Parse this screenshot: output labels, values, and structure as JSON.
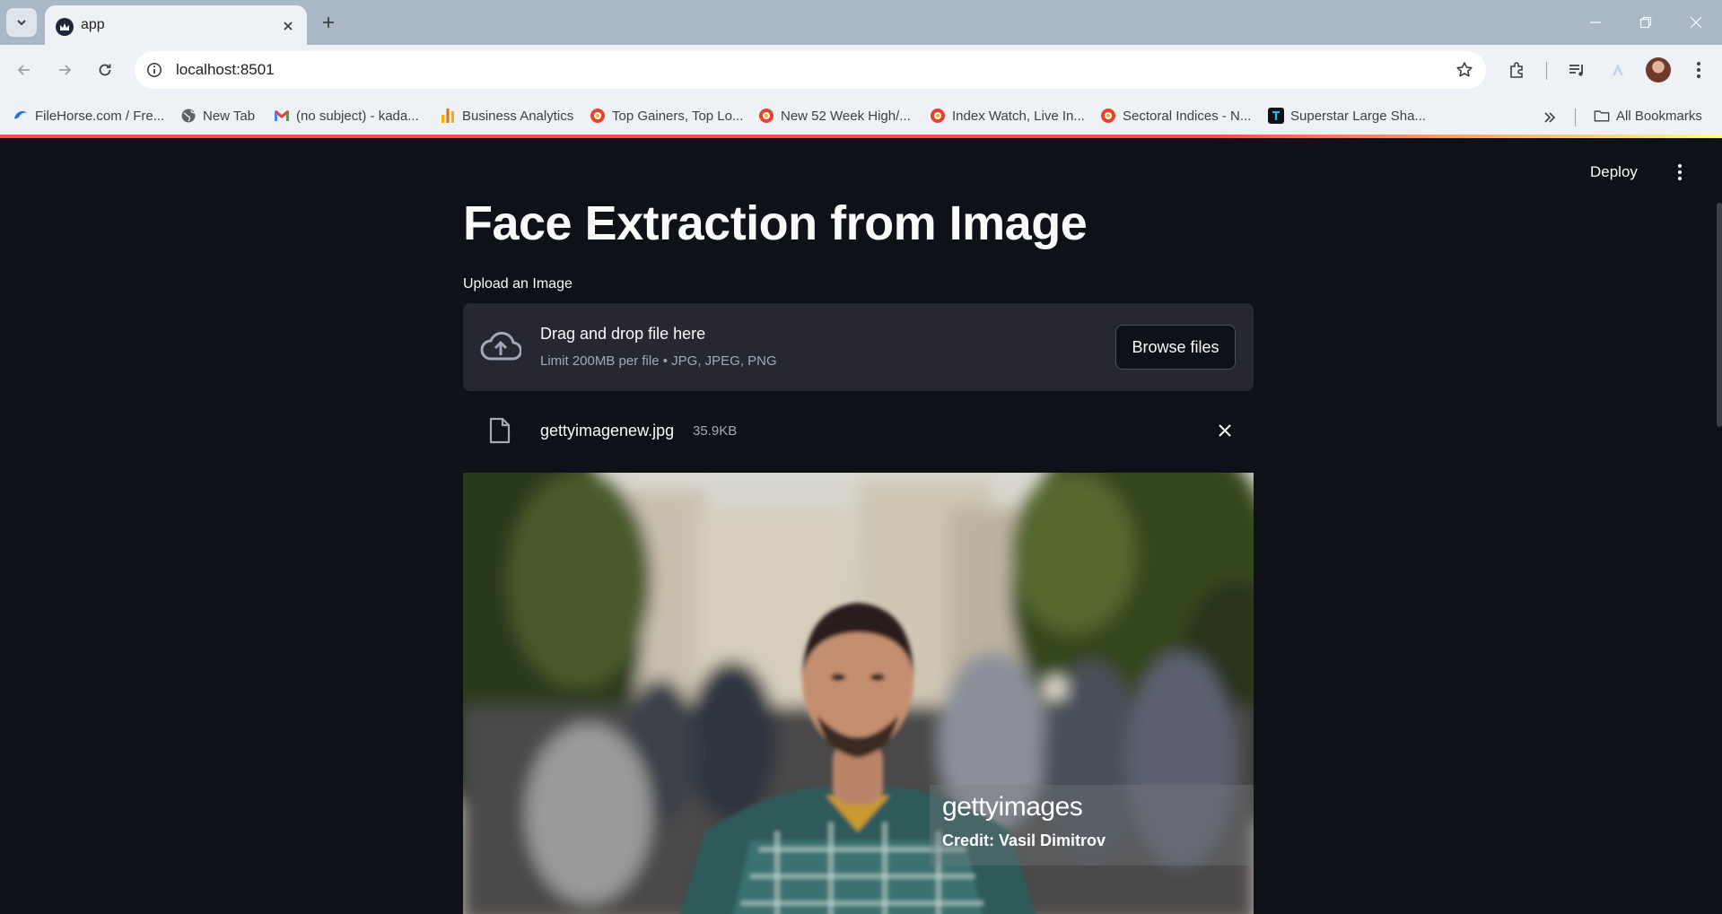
{
  "browser": {
    "tab_title": "app",
    "url": "localhost:8501",
    "bookmarks": [
      {
        "label": "FileHorse.com / Fre...",
        "icon": "filehorse-icon"
      },
      {
        "label": "New Tab",
        "icon": "globe-icon"
      },
      {
        "label": "(no subject) - kada...",
        "icon": "gmail-icon"
      },
      {
        "label": "Business Analytics",
        "icon": "analytics-icon"
      },
      {
        "label": "Top Gainers, Top Lo...",
        "icon": "moneycontrol-icon"
      },
      {
        "label": "New 52 Week High/...",
        "icon": "moneycontrol-icon"
      },
      {
        "label": "Index Watch, Live In...",
        "icon": "moneycontrol-icon"
      },
      {
        "label": "Sectoral Indices - N...",
        "icon": "moneycontrol-icon"
      },
      {
        "label": "Superstar Large Sha...",
        "icon": "trendlyne-icon"
      }
    ],
    "all_bookmarks_label": "All Bookmarks"
  },
  "app": {
    "deploy_label": "Deploy",
    "title": "Face Extraction from Image",
    "uploader": {
      "label": "Upload an Image",
      "drop_text": "Drag and drop file here",
      "limit_text": "Limit 200MB per file • JPG, JPEG, PNG",
      "browse_label": "Browse files"
    },
    "file": {
      "name": "gettyimagenew.jpg",
      "size": "35.9KB"
    },
    "image": {
      "watermark_brand": "gettyimages",
      "watermark_credit": "Credit: Vasil Dimitrov"
    }
  },
  "colors": {
    "background": "#0e1117",
    "surface": "#262730",
    "text": "#fafafa",
    "muted": "#a3a8b8",
    "accent": "#ff4b4b"
  }
}
